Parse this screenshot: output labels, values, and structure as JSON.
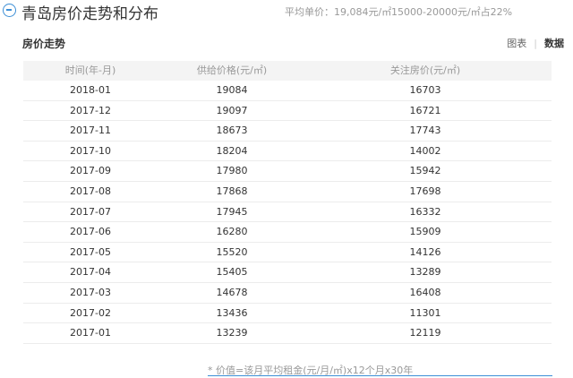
{
  "header": {
    "title": "青岛房价走势和分布",
    "avg_price": "平均单价：19,084元/㎡",
    "distribution": "15000-20000元/㎡占22%"
  },
  "section": {
    "title": "房价走势",
    "toggle_chart": "图表",
    "toggle_sep": "|",
    "toggle_data": "数据"
  },
  "table": {
    "headers": [
      "时间(年-月)",
      "供给价格(元/㎡)",
      "关注房价(元/㎡)"
    ],
    "rows": [
      [
        "2018-01",
        "19084",
        "16703"
      ],
      [
        "2017-12",
        "19097",
        "16721"
      ],
      [
        "2017-11",
        "18673",
        "17743"
      ],
      [
        "2017-10",
        "18204",
        "14002"
      ],
      [
        "2017-09",
        "17980",
        "15942"
      ],
      [
        "2017-08",
        "17868",
        "17698"
      ],
      [
        "2017-07",
        "17945",
        "16332"
      ],
      [
        "2017-06",
        "16280",
        "15909"
      ],
      [
        "2017-05",
        "15520",
        "14126"
      ],
      [
        "2017-04",
        "15405",
        "13289"
      ],
      [
        "2017-03",
        "14678",
        "16408"
      ],
      [
        "2017-02",
        "13436",
        "11301"
      ],
      [
        "2017-01",
        "13239",
        "12119"
      ]
    ]
  },
  "footnote": "* 价值=该月平均租金(元/月/㎡)x12个月x30年",
  "colors": {
    "accent": "#3d8fd6",
    "header_bg": "#f4f4f4"
  },
  "icons": {
    "collapse": "minus-circle-icon"
  }
}
